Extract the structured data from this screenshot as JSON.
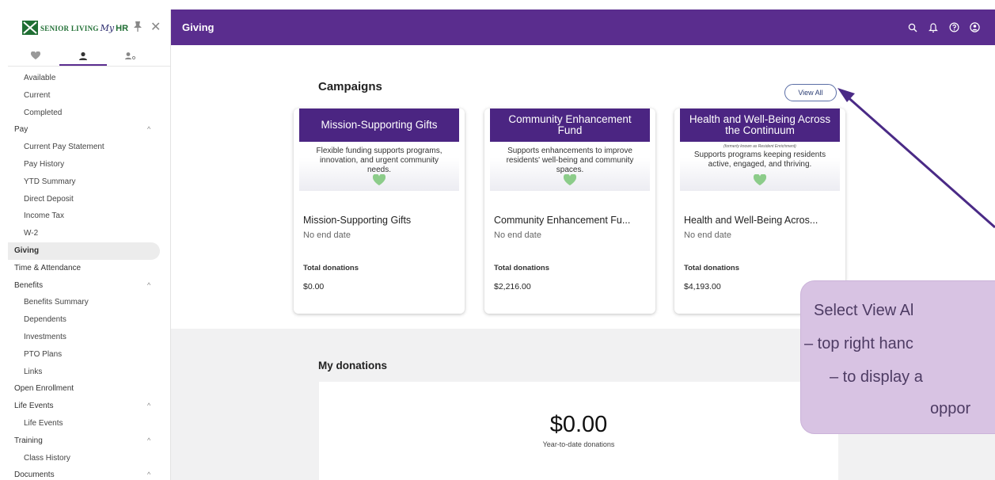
{
  "sidebar": {
    "logo": {
      "org": "Senior Living",
      "my": "My",
      "hr": "HR"
    },
    "tabs": [
      "favorites",
      "profile",
      "team"
    ],
    "items": [
      {
        "label": "Available",
        "level": "child"
      },
      {
        "label": "Current",
        "level": "child"
      },
      {
        "label": "Completed",
        "level": "child"
      },
      {
        "label": "Pay",
        "level": "parent",
        "caret": "^"
      },
      {
        "label": "Current Pay Statement",
        "level": "child"
      },
      {
        "label": "Pay History",
        "level": "child"
      },
      {
        "label": "YTD Summary",
        "level": "child"
      },
      {
        "label": "Direct Deposit",
        "level": "child"
      },
      {
        "label": "Income Tax",
        "level": "child"
      },
      {
        "label": "W-2",
        "level": "child"
      },
      {
        "label": "Giving",
        "level": "parent",
        "active": true
      },
      {
        "label": "Time & Attendance",
        "level": "parent"
      },
      {
        "label": "Benefits",
        "level": "parent",
        "caret": "^"
      },
      {
        "label": "Benefits Summary",
        "level": "child"
      },
      {
        "label": "Dependents",
        "level": "child"
      },
      {
        "label": "Investments",
        "level": "child"
      },
      {
        "label": "PTO Plans",
        "level": "child"
      },
      {
        "label": "Links",
        "level": "child"
      },
      {
        "label": "Open Enrollment",
        "level": "parent"
      },
      {
        "label": "Life Events",
        "level": "parent",
        "caret": "^"
      },
      {
        "label": "Life Events",
        "level": "child"
      },
      {
        "label": "Training",
        "level": "parent",
        "caret": "^"
      },
      {
        "label": "Class History",
        "level": "child"
      },
      {
        "label": "Documents",
        "level": "parent",
        "caret": "^"
      }
    ]
  },
  "topbar": {
    "title": "Giving",
    "icons": [
      "search-icon",
      "bell-icon",
      "help-icon",
      "account-icon"
    ],
    "color": "#5a2d8e"
  },
  "main": {
    "campaigns_title": "Campaigns",
    "view_all_label": "View All",
    "campaigns": [
      {
        "banner_title": "Mission-Supporting Gifts",
        "banner_note": "",
        "banner_desc": "Flexible funding supports programs, innovation, and urgent community needs.",
        "name": "Mission-Supporting Gifts",
        "end_date": "No end date",
        "total_label": "Total donations",
        "total": "$0.00"
      },
      {
        "banner_title": "Community Enhancement Fund",
        "banner_note": "",
        "banner_desc": "Supports enhancements to improve residents' well-being and community spaces.",
        "name": "Community Enhancement Fu...",
        "end_date": "No end date",
        "total_label": "Total donations",
        "total": "$2,216.00"
      },
      {
        "banner_title": "Health and Well-Being Across the Continuum",
        "banner_note": "(formerly known as Resident Enrichment)",
        "banner_desc": "Supports programs keeping residents active, engaged, and thriving.",
        "name": "Health and Well-Being Acros...",
        "end_date": "No end date",
        "total_label": "Total donations",
        "total": "$4,193.00"
      }
    ],
    "my_donations_title": "My donations",
    "ytd_amount": "$0.00",
    "ytd_label": "Year-to-date donations"
  },
  "annotation": {
    "lines": [
      "Select View Al",
      "– top right hanc",
      "– to display a",
      "oppor"
    ],
    "color": "#d8c3e3",
    "arrow_color": "#4a2a86"
  }
}
